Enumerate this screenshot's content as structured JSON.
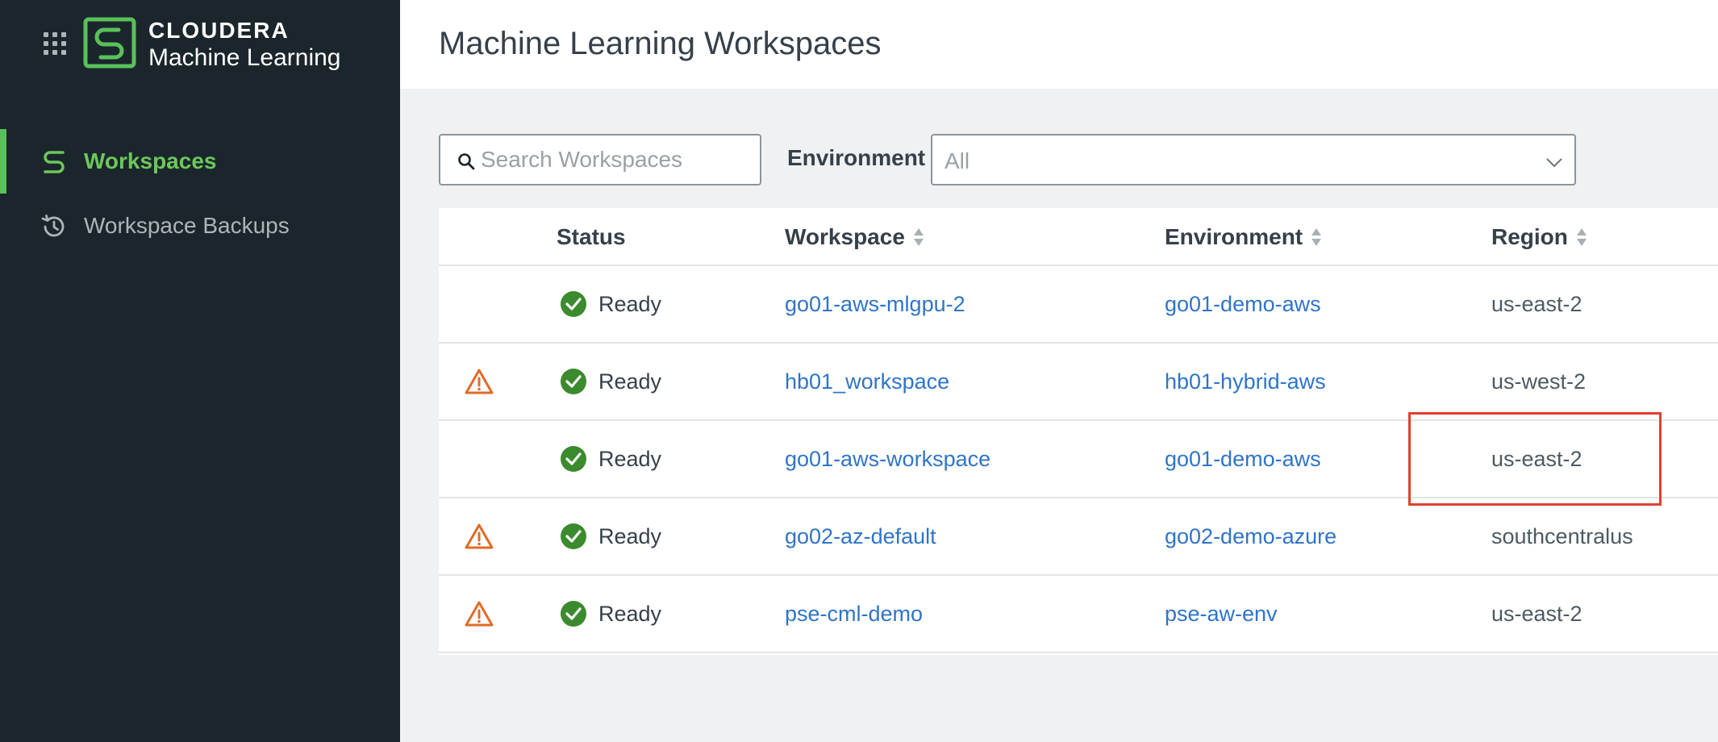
{
  "brand": {
    "top": "CLOUDERA",
    "bottom": "Machine Learning",
    "accent_color": "#5ac15a"
  },
  "sidebar": {
    "items": [
      {
        "label": "Workspaces",
        "icon": "workspaces-icon",
        "active": true
      },
      {
        "label": "Workspace Backups",
        "icon": "history-icon",
        "active": false
      }
    ]
  },
  "header": {
    "title": "Machine Learning Workspaces"
  },
  "search": {
    "placeholder": "Search Workspaces",
    "value": ""
  },
  "filter": {
    "label": "Environment",
    "selected": "All"
  },
  "table": {
    "columns": [
      "Status",
      "Workspace",
      "Environment",
      "Region"
    ],
    "rows": [
      {
        "warning": false,
        "status": "Ready",
        "workspace": "go01-aws-mlgpu-2",
        "environment": "go01-demo-aws",
        "region": "us-east-2"
      },
      {
        "warning": true,
        "status": "Ready",
        "workspace": "hb01_workspace",
        "environment": "hb01-hybrid-aws",
        "region": "us-west-2"
      },
      {
        "warning": false,
        "status": "Ready",
        "workspace": "go01-aws-workspace",
        "environment": "go01-demo-aws",
        "region": "us-east-2"
      },
      {
        "warning": true,
        "status": "Ready",
        "workspace": "go02-az-default",
        "environment": "go02-demo-azure",
        "region": "southcentralus"
      },
      {
        "warning": true,
        "status": "Ready",
        "workspace": "pse-cml-demo",
        "environment": "pse-aw-env",
        "region": "us-east-2"
      }
    ]
  },
  "colors": {
    "link": "#2f74c9",
    "ready": "#3c8a2e",
    "warning": "#e06b25",
    "highlight": "#e0402f"
  }
}
